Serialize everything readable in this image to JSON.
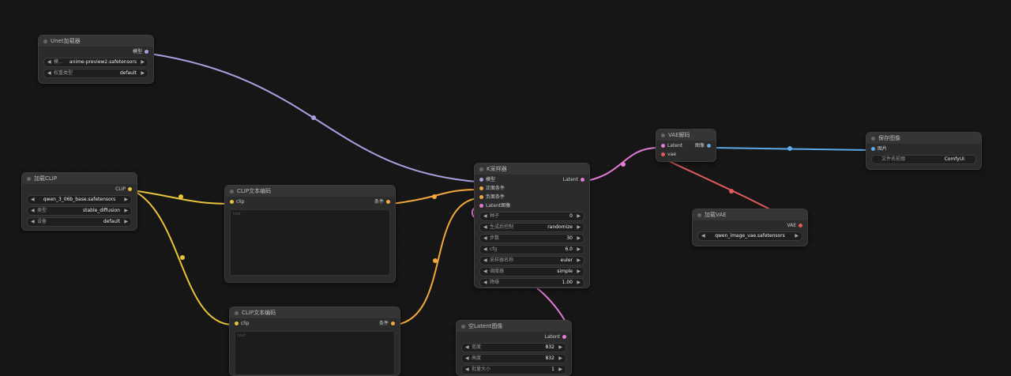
{
  "colors": {
    "model": "#a99fe0",
    "clip": "#e8c33a",
    "cond": "#f3a73c",
    "latent": "#e37ad6",
    "vae": "#e05a5a",
    "image": "#5ca8e8"
  },
  "unet": {
    "title": "Unet加载器",
    "out": "模型",
    "model": "anime-preview2.safetensors",
    "model_prefix": "模...",
    "dtype_label": "权重类型",
    "dtype": "default"
  },
  "clip_loader": {
    "title": "加载CLIP",
    "out": "CLIP",
    "clip_name": "qwen_3_06b_base.safetensors",
    "type_label": "类型",
    "type": "stable_diffusion",
    "device_label": "设备",
    "device": "default"
  },
  "clip_pos": {
    "title": "CLIP文本编码",
    "in": "clip",
    "out": "条件",
    "placeholder": "text"
  },
  "clip_neg": {
    "title": "CLIP文本编码",
    "in": "clip",
    "out": "条件",
    "placeholder": "text"
  },
  "ksampler": {
    "title": "K采样器",
    "inputs": [
      "模型",
      "正面条件",
      "负面条件",
      "Latent图像"
    ],
    "out": "Latent",
    "widgets": [
      {
        "label": "种子",
        "value": "0"
      },
      {
        "label": "生成后控制",
        "value": "randomize"
      },
      {
        "label": "步数",
        "value": "30"
      },
      {
        "label": "cfg",
        "value": "6.0"
      },
      {
        "label": "采样器名称",
        "value": "euler"
      },
      {
        "label": "调度器",
        "value": "simple"
      },
      {
        "label": "降噪",
        "value": "1.00"
      }
    ]
  },
  "empty_latent": {
    "title": "空Latent图像",
    "out": "Latent",
    "widgets": [
      {
        "label": "宽度",
        "value": "832"
      },
      {
        "label": "高度",
        "value": "832"
      },
      {
        "label": "批量大小",
        "value": "1"
      }
    ]
  },
  "vae_decode": {
    "title": "VAE解码",
    "in1": "Latent",
    "in2": "vae",
    "out": "图像"
  },
  "vae_loader": {
    "title": "加载VAE",
    "out": "VAE",
    "vae_name": "qwen_image_vae.safetensors"
  },
  "save_image": {
    "title": "保存图像",
    "in": "图片",
    "prefix_label": "文件名前缀",
    "prefix": "ComfyUI"
  }
}
